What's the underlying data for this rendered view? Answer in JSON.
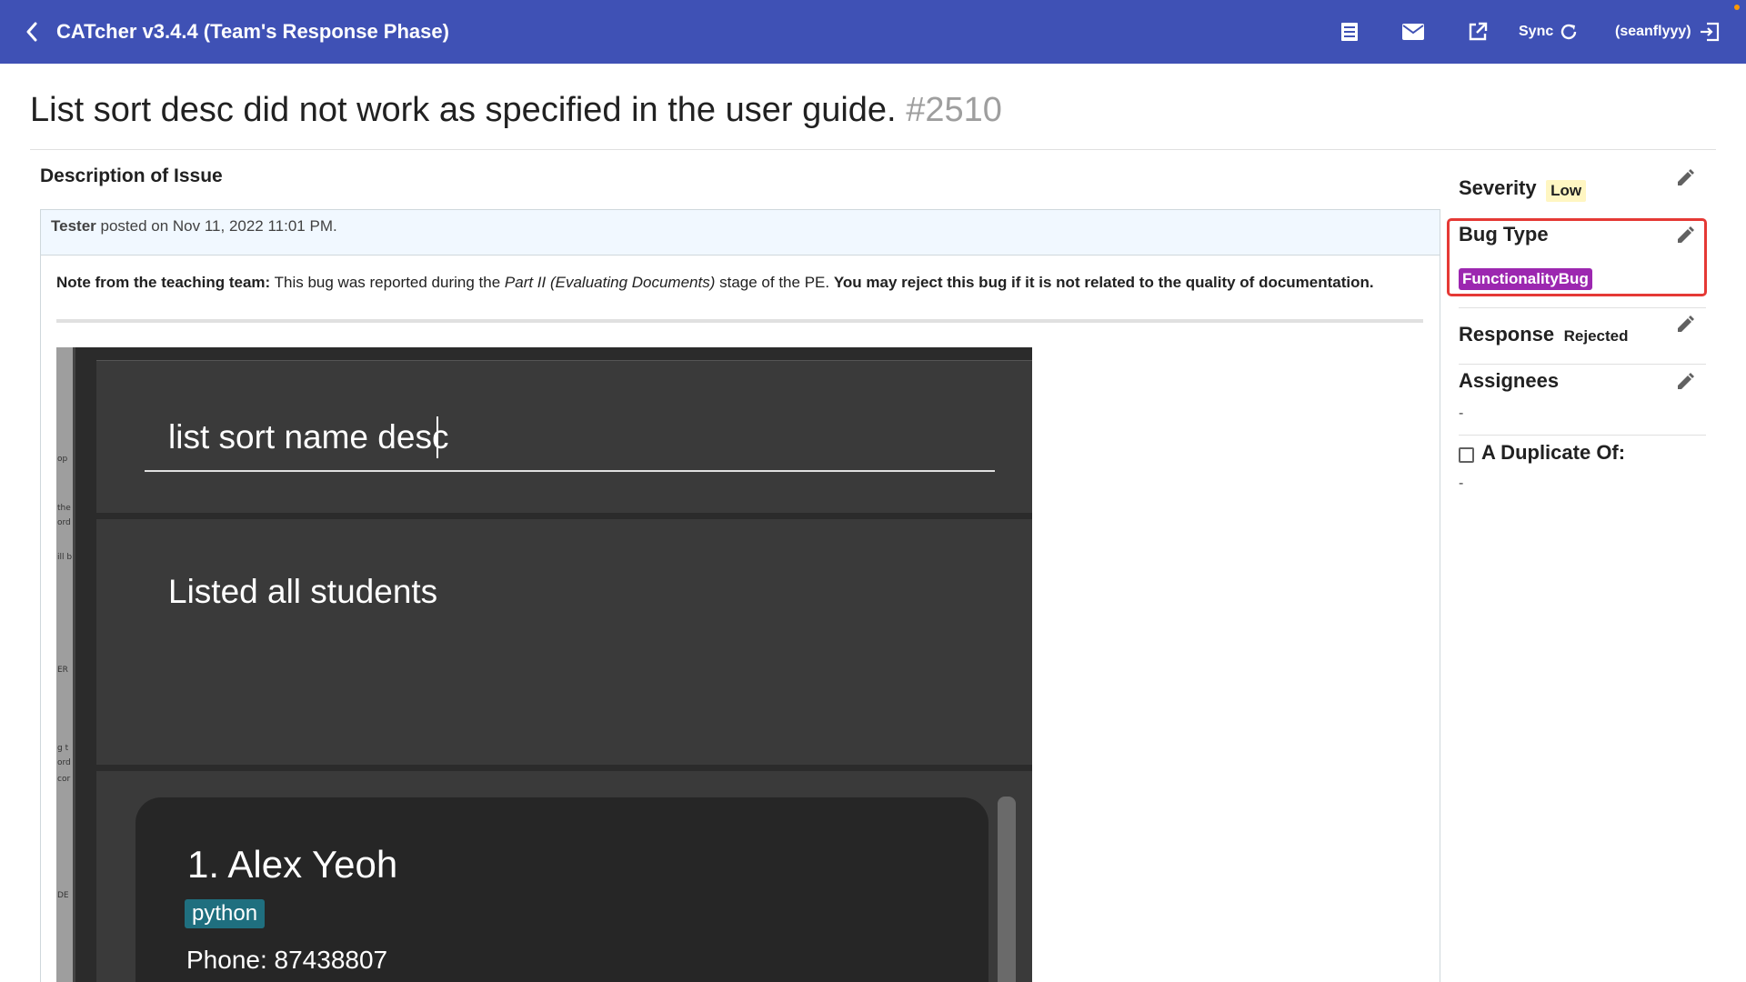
{
  "app": {
    "title": "CATcher v3.4.4  (Team's Response Phase)",
    "sync_label": "Sync",
    "user_label": "(seanflyyy)"
  },
  "icons": {
    "back": "chevron-left-icon",
    "list": "list-icon",
    "mail": "mail-icon",
    "open_external": "open-in-new-icon",
    "sync": "refresh-icon",
    "logout": "exit-icon",
    "edit": "pencil-icon"
  },
  "colors": {
    "app_bar": "#3f51b5",
    "severity_badge": "#fff6c2",
    "bug_type_badge": "#9c27b0",
    "highlight_border": "#e53935"
  },
  "issue": {
    "title": "List sort desc did not work as specified in the user guide.",
    "number": "#2510"
  },
  "description": {
    "heading": "Description of Issue",
    "author": "Tester",
    "posted_text": "posted on Nov 11, 2022 11:01 PM.",
    "note_label": "Note from the teaching team:",
    "note_text_1": "This bug was reported during the",
    "note_italic": "Part II (Evaluating Documents)",
    "note_text_2": "stage of the PE.",
    "note_bold": "You may reject this bug if it is not related to the quality of documentation."
  },
  "screenshot": {
    "command": "list sort name desc",
    "result": "Listed all students",
    "card_name": "1.  Alex Yeoh",
    "card_tag": "python",
    "card_phone": "Phone: 87438807",
    "strip_fragments": [
      "op",
      "the",
      "ord",
      "ill b",
      "ER",
      "g t",
      "ord",
      "cor",
      "DE"
    ]
  },
  "sidebar": {
    "severity_label": "Severity",
    "severity_value": "Low",
    "bug_type_label": "Bug Type",
    "bug_type_value": "FunctionalityBug",
    "response_label": "Response",
    "response_value": "Rejected",
    "assignees_label": "Assignees",
    "assignees_value": "-",
    "duplicate_label": "A Duplicate Of:",
    "duplicate_value": "-"
  }
}
